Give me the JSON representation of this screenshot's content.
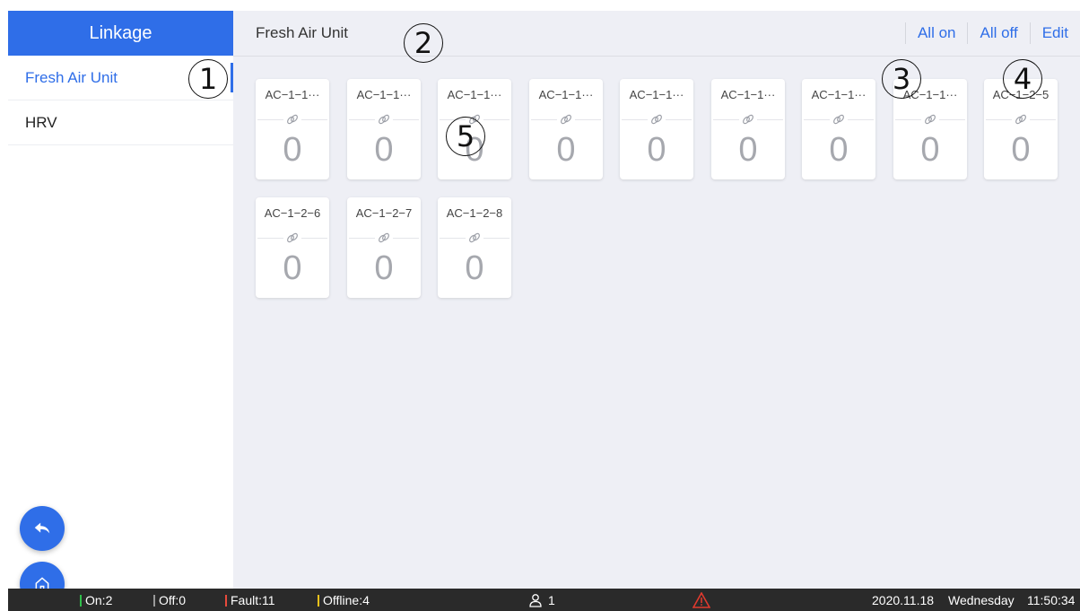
{
  "sidebar": {
    "header": "Linkage",
    "items": [
      {
        "label": "Fresh Air Unit",
        "active": true
      },
      {
        "label": "HRV",
        "active": false
      }
    ]
  },
  "topbar": {
    "title": "Fresh Air Unit",
    "actions": [
      "All on",
      "All off",
      "Edit"
    ]
  },
  "cards": [
    {
      "name": "AC−1−1···",
      "value": "0"
    },
    {
      "name": "AC−1−1···",
      "value": "0"
    },
    {
      "name": "AC−1−1···",
      "value": "0"
    },
    {
      "name": "AC−1−1···",
      "value": "0"
    },
    {
      "name": "AC−1−1···",
      "value": "0"
    },
    {
      "name": "AC−1−1···",
      "value": "0"
    },
    {
      "name": "AC−1−1···",
      "value": "0"
    },
    {
      "name": "AC−1−1···",
      "value": "0"
    },
    {
      "name": "AC−1−2−5",
      "value": "0"
    },
    {
      "name": "AC−1−2−6",
      "value": "0"
    },
    {
      "name": "AC−1−2−7",
      "value": "0"
    },
    {
      "name": "AC−1−2−8",
      "value": "0"
    }
  ],
  "annotations": [
    "1",
    "2",
    "3",
    "4",
    "5"
  ],
  "status": {
    "on": "On:2",
    "off": "Off:0",
    "fault": "Fault:11",
    "offline": "Offline:4",
    "users": "1",
    "date": "2020.11.18",
    "weekday": "Wednesday",
    "time": "11:50:34"
  },
  "colors": {
    "accent": "#2f6ee8",
    "on": "#2fbf4a",
    "off": "#9a9a9a",
    "fault": "#e84a3c",
    "offline": "#f2c21b",
    "warning": "#e03a2e"
  },
  "icons": {
    "link": "link-icon",
    "back": "back-arrow-icon",
    "home": "home-icon",
    "user": "user-icon",
    "warning": "warning-icon"
  }
}
